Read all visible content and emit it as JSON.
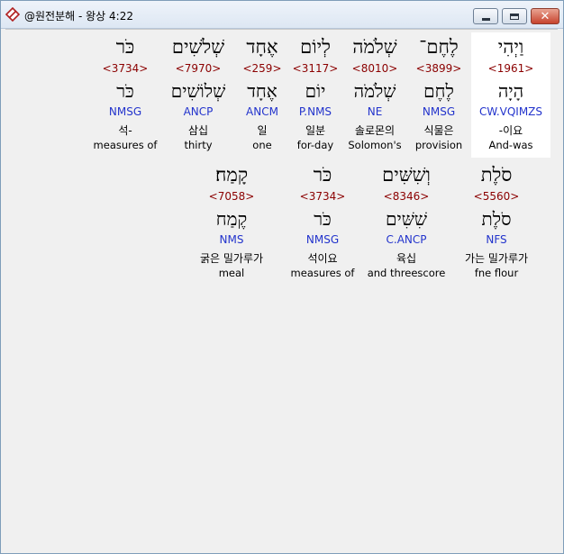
{
  "window": {
    "title": "@원전분해 - 왕상 4:22"
  },
  "rows": [
    {
      "words": [
        {
          "surface": "וַיְהִי",
          "strong": "<1961>",
          "lemma": "הָיָה",
          "morph": "CW.VQIMZS",
          "korean": "-이요",
          "english": "And-was",
          "highlighted": true
        },
        {
          "surface": "לֶחֶם־",
          "strong": "<3899>",
          "lemma": "לֶחֶם",
          "morph": "NMSG",
          "korean": "식물은",
          "english": "provision"
        },
        {
          "surface": "שְׁלֹמֹה",
          "strong": "<8010>",
          "lemma": "שְׁלֹמֹה",
          "morph": "NE",
          "korean": "솔로몬의",
          "english": "Solomon's"
        },
        {
          "surface": "לְיוֹם",
          "strong": "<3117>",
          "lemma": "יוֹם",
          "morph": "P.NMS",
          "korean": "일분",
          "english": "for-day"
        },
        {
          "surface": "אֶחָד",
          "strong": "<259>",
          "lemma": "אֶחָד",
          "morph": "ANCM",
          "korean": "일",
          "english": "one"
        },
        {
          "surface": "שְׁלֹשִׁים",
          "strong": "<7970>",
          "lemma": "שְׁלוֹשִׁים",
          "morph": "ANCP",
          "korean": "삼십",
          "english": "thirty"
        },
        {
          "surface": "כֹּר",
          "strong": "<3734>",
          "lemma": "כֹּר",
          "morph": "NMSG",
          "korean": "석-",
          "english": "measures of"
        }
      ]
    },
    {
      "words": [
        {
          "surface": "סֹלֶת",
          "strong": "<5560>",
          "lemma": "סֹלֶת",
          "morph": "NFS",
          "korean": "가는 밀가루가",
          "english": "fne flour"
        },
        {
          "surface": "וְשִׁשִּׁים",
          "strong": "<8346>",
          "lemma": "שִׁשִּׁים",
          "morph": "C.ANCP",
          "korean": "육십",
          "english": "and threescore"
        },
        {
          "surface": "כֹּר",
          "strong": "<3734>",
          "lemma": "כֹּר",
          "morph": "NMSG",
          "korean": "석이요",
          "english": "measures of"
        },
        {
          "surface": "קָמַח׃",
          "strong": "<7058>",
          "lemma": "קֶמַח",
          "morph": "NMS",
          "korean": "굵은 밀가루가",
          "english": "meal"
        }
      ]
    }
  ],
  "colors": {
    "strong": "#8b0000",
    "morph": "#2233cc",
    "highlight": "#ffffff",
    "background": "#f0f0f0"
  }
}
